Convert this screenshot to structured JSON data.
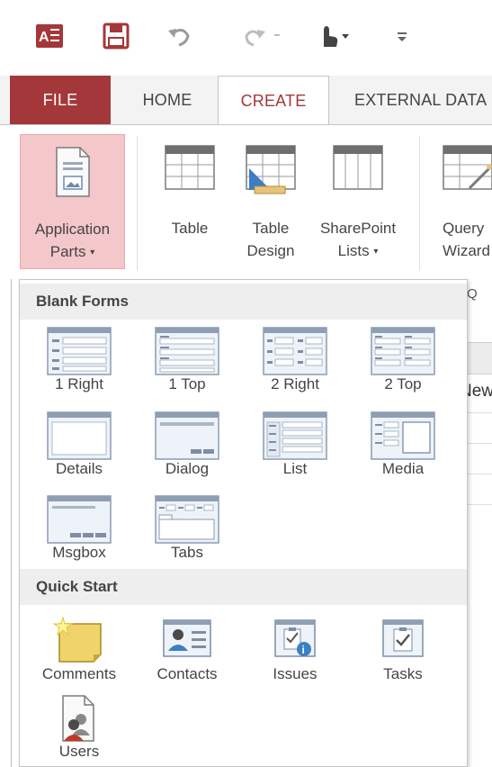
{
  "quick_access": {
    "items": [
      "access-logo-icon",
      "save-icon",
      "undo-icon",
      "redo-icon",
      "touch-mode-icon",
      "customize-icon"
    ]
  },
  "colors": {
    "accent": "#a4373a",
    "active_button_bg": "#f4c7ca",
    "section_header_bg": "#eeeeee"
  },
  "tabs": {
    "file": "FILE",
    "home": "HOME",
    "create": "CREATE",
    "external": "EXTERNAL DATA"
  },
  "ribbon": {
    "application_parts": [
      "Application",
      "Parts"
    ],
    "table": "Table",
    "table_design": [
      "Table",
      "Design"
    ],
    "sharepoint_lists": [
      "SharePoint",
      "Lists"
    ],
    "query_wizard": [
      "Query",
      "Wizard"
    ]
  },
  "background": {
    "tab_letter": "Q",
    "new_text": "New"
  },
  "gallery": {
    "blank_forms_title": "Blank Forms",
    "blank_forms": [
      {
        "label": "1 Right"
      },
      {
        "label": "1 Top"
      },
      {
        "label": "2 Right"
      },
      {
        "label": "2 Top"
      },
      {
        "label": "Details"
      },
      {
        "label": "Dialog"
      },
      {
        "label": "List"
      },
      {
        "label": "Media"
      },
      {
        "label": "Msgbox"
      },
      {
        "label": "Tabs"
      }
    ],
    "quick_start_title": "Quick Start",
    "quick_start": [
      {
        "label": "Comments"
      },
      {
        "label": "Contacts"
      },
      {
        "label": "Issues"
      },
      {
        "label": "Tasks"
      },
      {
        "label": "Users"
      }
    ]
  }
}
